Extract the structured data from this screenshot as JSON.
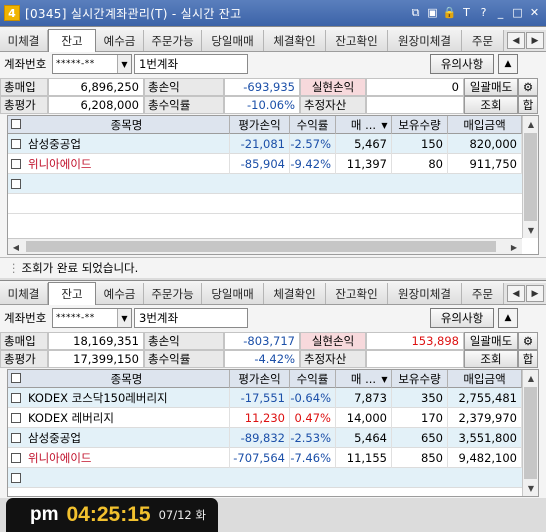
{
  "window": {
    "badge": "4",
    "title": "[0345] 실시간계좌관리(T) - 실시간 잔고"
  },
  "title_icons": [
    "window-link-icon",
    "window-split-icon",
    "lock-icon",
    "font-icon",
    "help-icon",
    "minimize-icon",
    "maximize-icon",
    "close-icon"
  ],
  "title_glyphs": [
    "⧉",
    "▣",
    "🔒",
    "T",
    "?",
    "_",
    "□",
    "✕"
  ],
  "colors": {
    "titlebar": "#4870b4",
    "negative": "#1b4fa8",
    "positive": "#dd1111",
    "stock_red": "#c0102a",
    "clock_time": "#f2c12e",
    "pink_cell": "#f7d9dc"
  },
  "panes": [
    {
      "tabs": [
        "미체결",
        "잔고",
        "예수금",
        "주문가능",
        "당일매매",
        "체결확인",
        "잔고확인",
        "원장미체결",
        "주문"
      ],
      "active_tab": "잔고",
      "account_label": "계좌번호",
      "account_number": "*****-**",
      "account_name": "1번계좌",
      "notice_button": "유의사항",
      "summary": {
        "total_buy_label": "총매입",
        "total_buy": "6,896,250",
        "total_pnl_label": "총손익",
        "total_pnl": "-693,935",
        "realized_label": "실현손익",
        "realized": "0",
        "bulk_sell": "일괄매도",
        "total_eval_label": "총평가",
        "total_eval": "6,208,000",
        "total_return_label": "총수익률",
        "total_return": "-10.06%",
        "est_asset_label": "추정자산",
        "est_asset": "",
        "query_button": "조회",
        "sum_button": "합"
      },
      "columns": [
        "종목명",
        "평가손익",
        "수익률",
        "매 ...",
        "보유수량",
        "매입금액"
      ],
      "rows": [
        {
          "name": "삼성중공업",
          "pnl": "-21,081",
          "rate": "-2.57%",
          "buy_price": "5,467",
          "qty": "150",
          "amount": "820,000",
          "pnl_sign": "neg",
          "name_red": false
        },
        {
          "name": "위니아에이드",
          "pnl": "-85,904",
          "rate": "-9.42%",
          "buy_price": "11,397",
          "qty": "80",
          "amount": "911,750",
          "pnl_sign": "neg",
          "name_red": true
        }
      ],
      "status": "조회가 완료 되었습니다."
    },
    {
      "tabs": [
        "미체결",
        "잔고",
        "예수금",
        "주문가능",
        "당일매매",
        "체결확인",
        "잔고확인",
        "원장미체결",
        "주문"
      ],
      "active_tab": "잔고",
      "account_label": "계좌번호",
      "account_number": "*****-**",
      "account_name": "3번계좌",
      "notice_button": "유의사항",
      "summary": {
        "total_buy_label": "총매입",
        "total_buy": "18,169,351",
        "total_pnl_label": "총손익",
        "total_pnl": "-803,717",
        "realized_label": "실현손익",
        "realized": "153,898",
        "bulk_sell": "일괄매도",
        "total_eval_label": "총평가",
        "total_eval": "17,399,150",
        "total_return_label": "총수익률",
        "total_return": "-4.42%",
        "est_asset_label": "추정자산",
        "est_asset": "",
        "query_button": "조회",
        "sum_button": "합"
      },
      "columns": [
        "종목명",
        "평가손익",
        "수익률",
        "매 ...",
        "보유수량",
        "매입금액"
      ],
      "rows": [
        {
          "name": "KODEX 코스닥150레버리지",
          "pnl": "-17,551",
          "rate": "-0.64%",
          "buy_price": "7,873",
          "qty": "350",
          "amount": "2,755,481",
          "pnl_sign": "neg",
          "name_red": false
        },
        {
          "name": "KODEX 레버리지",
          "pnl": "11,230",
          "rate": "0.47%",
          "buy_price": "14,000",
          "qty": "170",
          "amount": "2,379,970",
          "pnl_sign": "pos",
          "name_red": false
        },
        {
          "name": "삼성중공업",
          "pnl": "-89,832",
          "rate": "-2.53%",
          "buy_price": "5,464",
          "qty": "650",
          "amount": "3,551,800",
          "pnl_sign": "neg",
          "name_red": false
        },
        {
          "name": "위니아에이드",
          "pnl": "-707,564",
          "rate": "-7.46%",
          "buy_price": "11,155",
          "qty": "850",
          "amount": "9,482,100",
          "pnl_sign": "neg",
          "name_red": true
        }
      ]
    }
  ],
  "clock": {
    "ampm": "pm",
    "time": "04:25:15",
    "date": "07/12 화"
  }
}
